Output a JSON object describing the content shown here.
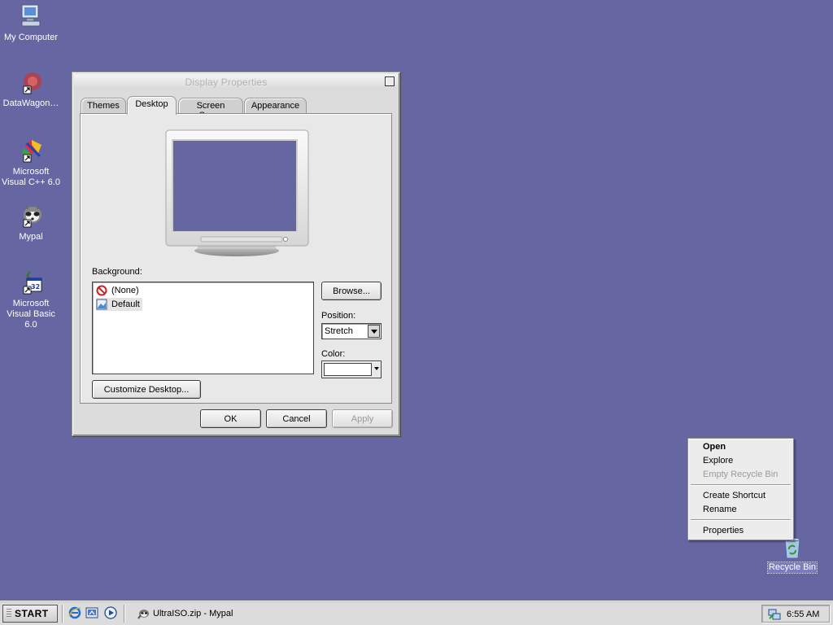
{
  "desktop": {
    "icons": [
      {
        "label": "My Computer",
        "icon": "my-computer-icon"
      },
      {
        "label": "DataWagon…",
        "icon": "datawagon-icon"
      },
      {
        "label": "Microsoft Visual C++ 6.0",
        "icon": "visual-cpp-icon"
      },
      {
        "label": "Mypal",
        "icon": "mypal-icon"
      },
      {
        "label": "Microsoft Visual Basic 6.0",
        "icon": "visual-basic-icon"
      },
      {
        "label": "Recycle Bin",
        "icon": "recycle-bin-icon"
      }
    ],
    "background_color": "#6666a2"
  },
  "window": {
    "title": "Display Properties",
    "tabs": [
      "Themes",
      "Desktop",
      "Screen Saver",
      "Appearance"
    ],
    "active_tab": "Desktop",
    "preview_color": "#6666a2",
    "background_label": "Background:",
    "background_items": [
      {
        "label": "(None)",
        "icon": "no-wallpaper-icon"
      },
      {
        "label": "Default",
        "icon": "image-file-icon",
        "selected": true
      }
    ],
    "browse_label": "Browse...",
    "position_label": "Position:",
    "position_value": "Stretch",
    "color_label": "Color:",
    "color_value": "#ffffff",
    "customize_label": "Customize Desktop...",
    "ok_label": "OK",
    "cancel_label": "Cancel",
    "apply_label": "Apply"
  },
  "context_menu": {
    "items": [
      {
        "label": "Open",
        "bold": true
      },
      {
        "label": "Explore"
      },
      {
        "label": "Empty Recycle Bin",
        "disabled": true
      },
      {
        "label": "Create Shortcut"
      },
      {
        "label": "Rename"
      },
      {
        "label": "Properties"
      }
    ]
  },
  "taskbar": {
    "start_label": "START",
    "quick_launch": [
      "internet-explorer-icon",
      "show-desktop-icon",
      "media-player-icon"
    ],
    "task_label": "UltraISO.zip - Mypal",
    "clock": "6:55 AM"
  }
}
